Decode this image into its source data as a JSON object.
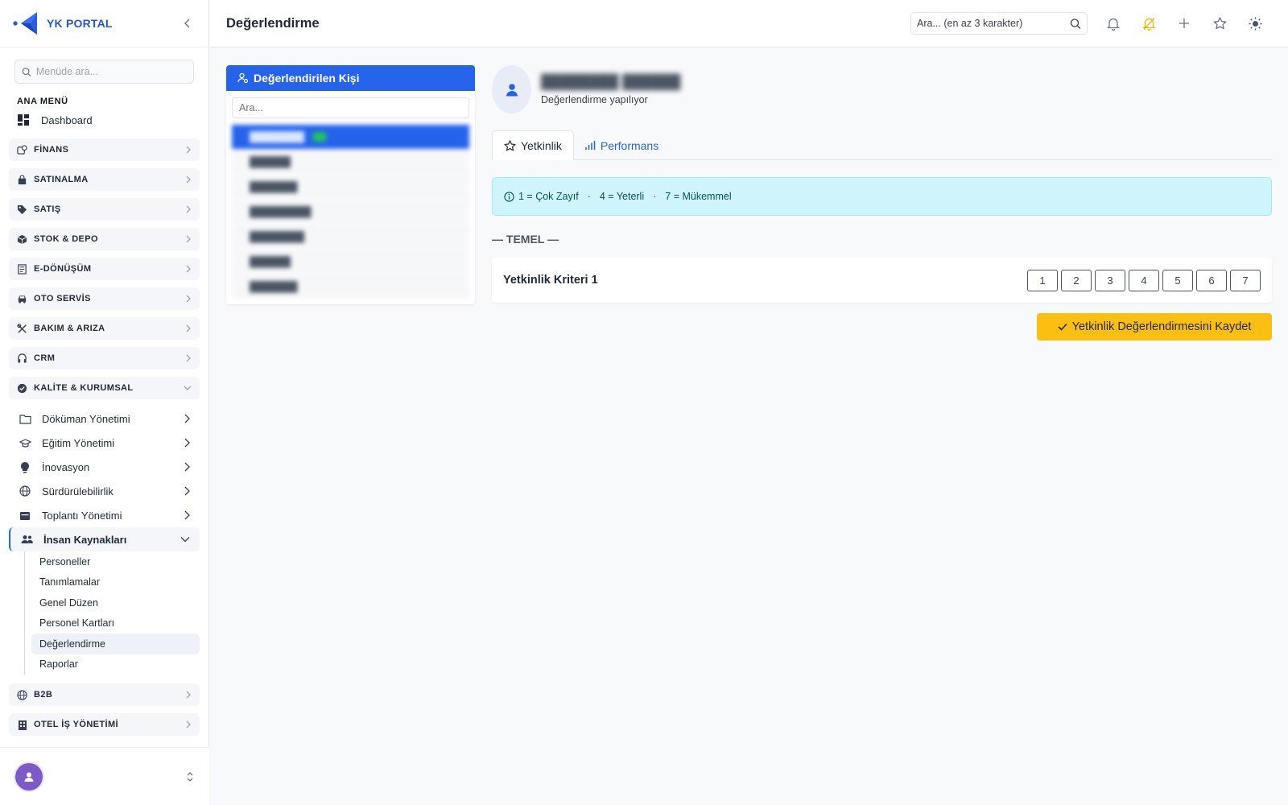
{
  "app": {
    "name": "YK PORTAL",
    "accent": "#2563eb"
  },
  "sidebar": {
    "search_placeholder": "Menüde ara...",
    "section_label": "ANA MENÜ",
    "dashboard": "Dashboard",
    "groups": [
      {
        "label": "FİNANS",
        "icon": "finance-icon"
      },
      {
        "label": "SATINALMA",
        "icon": "shopping-bag-icon"
      },
      {
        "label": "SATIŞ",
        "icon": "tag-icon"
      },
      {
        "label": "STOK & DEPO",
        "icon": "box-icon"
      },
      {
        "label": "E-DÖNÜŞÜM",
        "icon": "document-icon"
      },
      {
        "label": "OTO SERVİS",
        "icon": "car-icon"
      },
      {
        "label": "BAKIM & ARIZA",
        "icon": "tools-icon"
      },
      {
        "label": "CRM",
        "icon": "headset-icon"
      },
      {
        "label": "KALİTE & KURUMSAL",
        "icon": "quality-badge-icon"
      }
    ],
    "quality_items": [
      {
        "label": "Döküman Yönetimi",
        "icon": "folder-icon"
      },
      {
        "label": "Eğitim Yönetimi",
        "icon": "graduation-cap-icon"
      },
      {
        "label": "İnovasyon",
        "icon": "lightbulb-icon"
      },
      {
        "label": "Sürdürülebilirlik",
        "icon": "globe-icon"
      },
      {
        "label": "Toplantı Yönetimi",
        "icon": "calendar-icon"
      },
      {
        "label": "İnsan Kaynakları",
        "icon": "people-icon"
      }
    ],
    "hr_children": [
      "Personeller",
      "Tanımlamalar",
      "Genel Düzen",
      "Personel Kartları",
      "Değerlendirme",
      "Raporlar"
    ],
    "groups_after": [
      {
        "label": "B2B",
        "icon": "globe-icon"
      },
      {
        "label": "OTEL İŞ YÖNETİMİ",
        "icon": "building-icon"
      }
    ]
  },
  "header": {
    "title": "Değerlendirme",
    "search_placeholder": "Ara... (en az 3 karakter)"
  },
  "person_panel": {
    "title": "Değerlendirilen Kişi",
    "search_placeholder": "Ara..."
  },
  "evaluation": {
    "subtitle": "Değerlendirme yapılıyor",
    "tabs": [
      "Yetkinlik",
      "Performans"
    ],
    "legend": [
      "1 = Çok Zayıf",
      "4 = Yeterli",
      "7 = Mükemmel"
    ],
    "section": "— TEMEL —",
    "criterion": "Yetkinlik Kriteri 1",
    "scale": [
      "1",
      "2",
      "3",
      "4",
      "5",
      "6",
      "7"
    ],
    "save_label": "Yetkinlik Değerlendirmesini Kaydet",
    "save_color": "#fbbf12"
  }
}
